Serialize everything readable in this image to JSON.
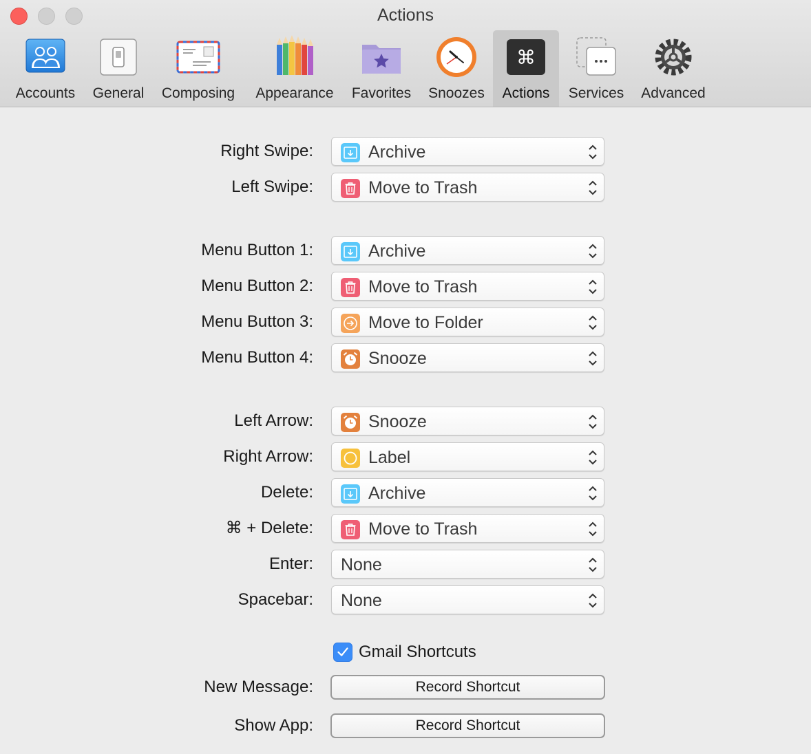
{
  "window": {
    "title": "Actions"
  },
  "toolbar": {
    "tabs": [
      {
        "label": "Accounts",
        "icon": "accounts-icon"
      },
      {
        "label": "General",
        "icon": "general-icon"
      },
      {
        "label": "Composing",
        "icon": "composing-icon"
      },
      {
        "label": "Appearance",
        "icon": "appearance-icon"
      },
      {
        "label": "Favorites",
        "icon": "favorites-icon"
      },
      {
        "label": "Snoozes",
        "icon": "snoozes-icon"
      },
      {
        "label": "Actions",
        "icon": "actions-icon",
        "selected": true
      },
      {
        "label": "Services",
        "icon": "services-icon"
      },
      {
        "label": "Advanced",
        "icon": "advanced-icon"
      }
    ]
  },
  "options": {
    "archive": "Archive",
    "trash": "Move to Trash",
    "folder": "Move to Folder",
    "snooze": "Snooze",
    "label": "Label",
    "none": "None"
  },
  "colors": {
    "archive": "#5ac8fa",
    "trash": "#ef5e74",
    "folder": "#f5a45a",
    "snooze": "#e3813d",
    "label": "#f7c13c",
    "checkbox": "#3b8df8"
  },
  "rows": {
    "right_swipe": {
      "label": "Right Swipe:",
      "value": "Archive",
      "icon": "archive-icon"
    },
    "left_swipe": {
      "label": "Left Swipe:",
      "value": "Move to Trash",
      "icon": "trash-icon"
    },
    "menu_button_1": {
      "label": "Menu Button 1:",
      "value": "Archive",
      "icon": "archive-icon"
    },
    "menu_button_2": {
      "label": "Menu Button 2:",
      "value": "Move to Trash",
      "icon": "trash-icon"
    },
    "menu_button_3": {
      "label": "Menu Button 3:",
      "value": "Move to Folder",
      "icon": "folder-icon"
    },
    "menu_button_4": {
      "label": "Menu Button 4:",
      "value": "Snooze",
      "icon": "snooze-icon"
    },
    "left_arrow": {
      "label": "Left Arrow:",
      "value": "Snooze",
      "icon": "snooze-icon"
    },
    "right_arrow": {
      "label": "Right Arrow:",
      "value": "Label",
      "icon": "label-icon"
    },
    "delete": {
      "label": "Delete:",
      "value": "Archive",
      "icon": "archive-icon"
    },
    "cmd_delete": {
      "label": "⌘ + Delete:",
      "value": "Move to Trash",
      "icon": "trash-icon"
    },
    "enter": {
      "label": "Enter:",
      "value": "None"
    },
    "spacebar": {
      "label": "Spacebar:",
      "value": "None"
    }
  },
  "gmail": {
    "label": "Gmail Shortcuts",
    "checked": true
  },
  "shortcuts": {
    "new_message": {
      "label": "New Message:",
      "button": "Record Shortcut"
    },
    "show_app": {
      "label": "Show App:",
      "button": "Record Shortcut"
    }
  }
}
